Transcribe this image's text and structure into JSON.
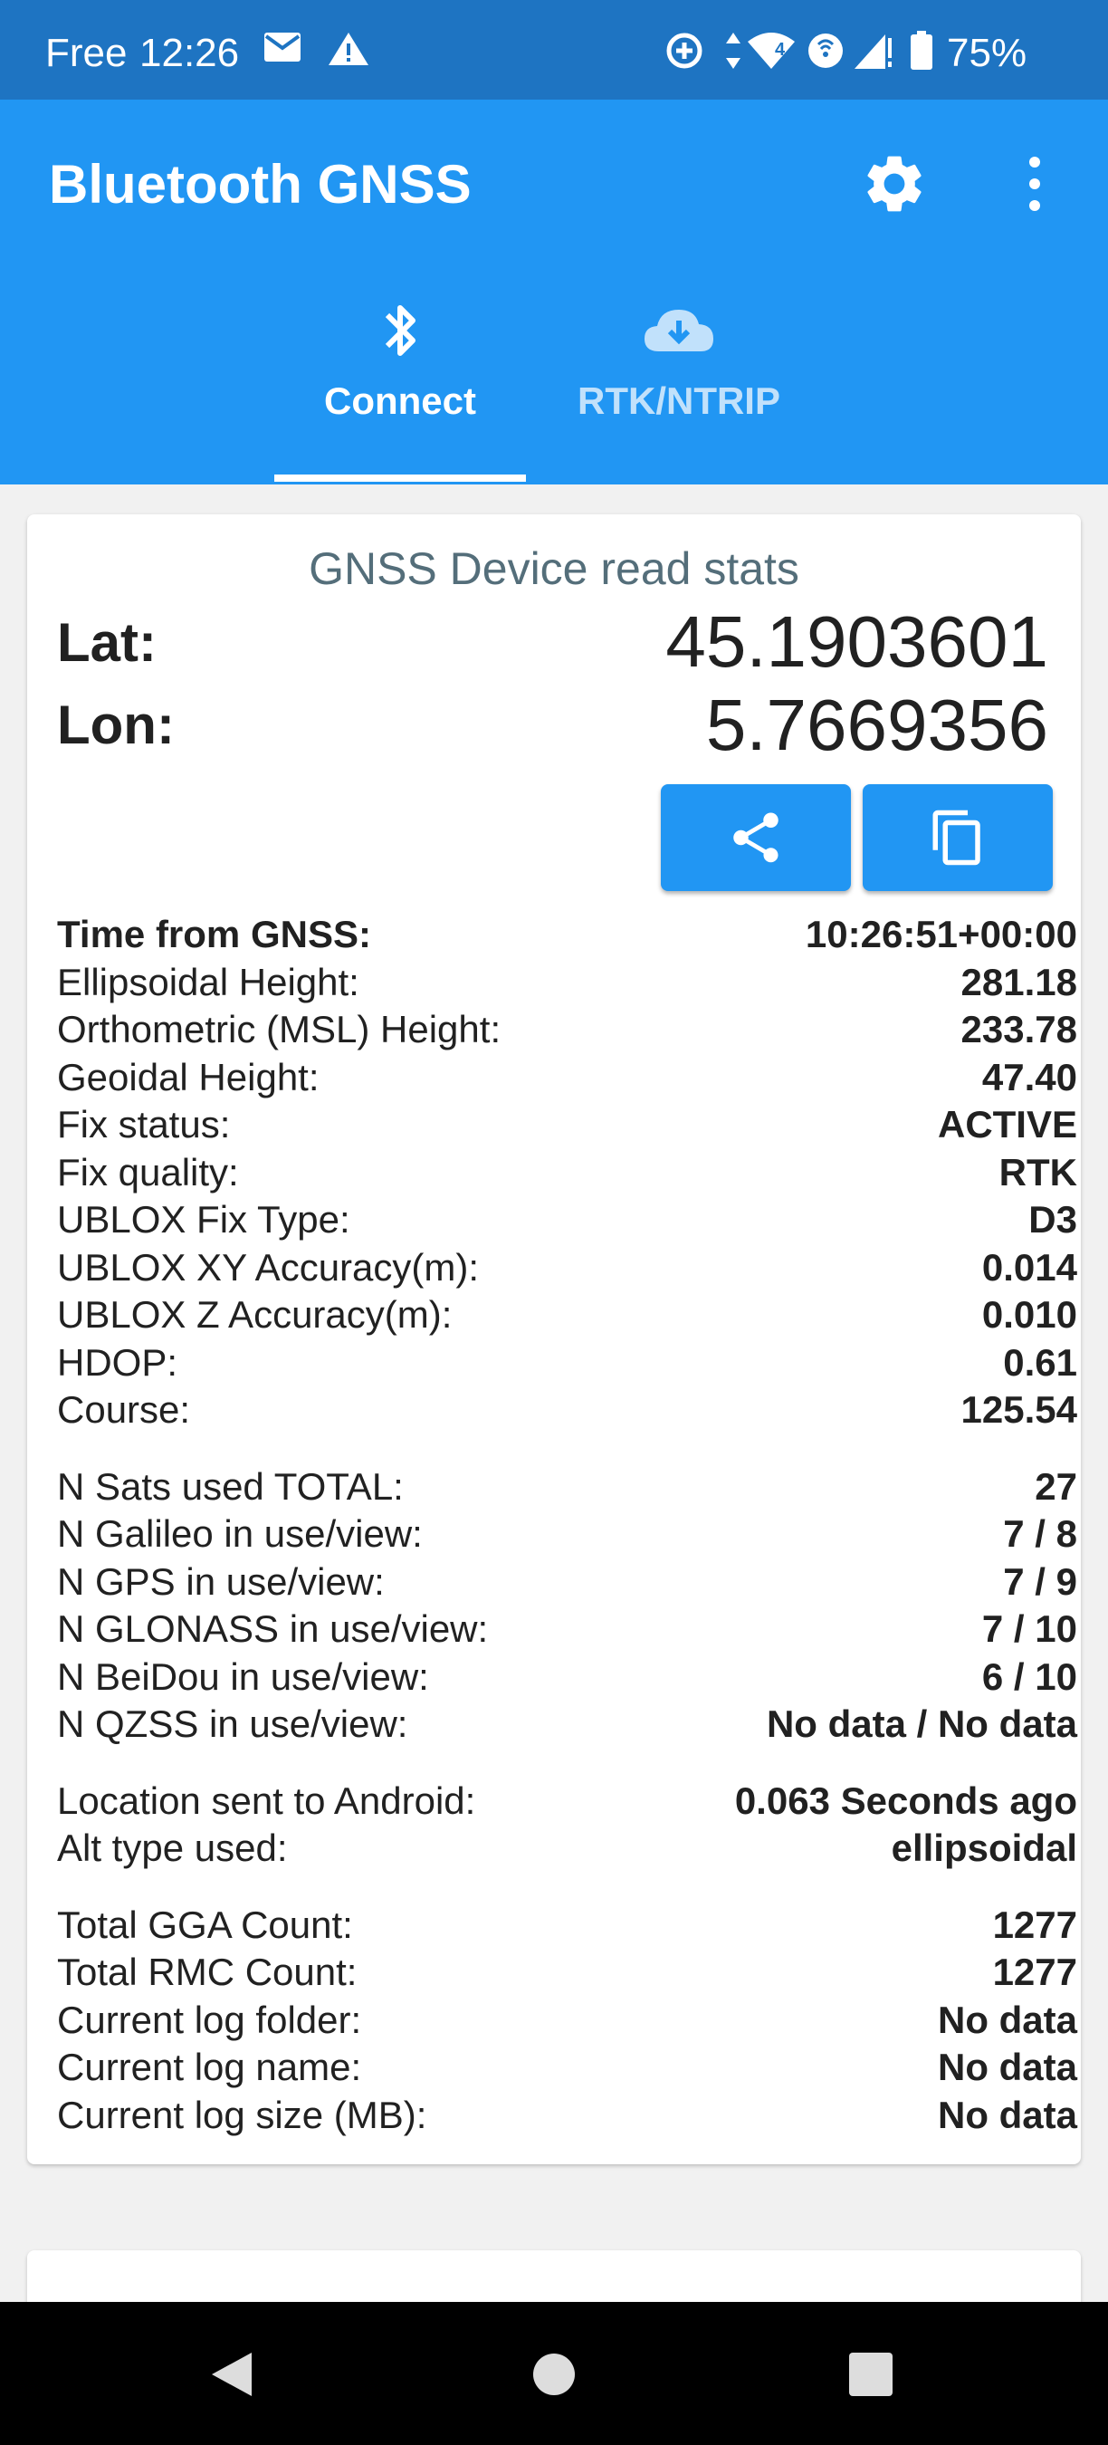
{
  "status_bar": {
    "carrier": "Free",
    "time": "12:26",
    "battery": "75%",
    "network_badge": "4"
  },
  "app_bar": {
    "title": "Bluetooth GNSS",
    "tabs": [
      {
        "label": "Connect",
        "icon": "bluetooth-icon",
        "selected": true
      },
      {
        "label": "RTK/NTRIP",
        "icon": "cloud-download-icon",
        "selected": false
      }
    ]
  },
  "card": {
    "title": "GNSS Device read stats",
    "lat_label": "Lat:",
    "lat_value": "45.1903601",
    "lon_label": "Lon:",
    "lon_value": "5.7669356",
    "stats_groups": [
      [
        {
          "label": "Time from GNSS:",
          "value": "10:26:51+00:00",
          "strong": true
        },
        {
          "label": "Ellipsoidal Height:",
          "value": "281.18"
        },
        {
          "label": "Orthometric (MSL) Height:",
          "value": "233.78"
        },
        {
          "label": "Geoidal Height:",
          "value": "47.40"
        },
        {
          "label": "Fix status:",
          "value": "ACTIVE"
        },
        {
          "label": "Fix quality:",
          "value": "RTK"
        },
        {
          "label": "UBLOX Fix Type:",
          "value": "D3"
        },
        {
          "label": "UBLOX XY Accuracy(m):",
          "value": "0.014"
        },
        {
          "label": "UBLOX Z Accuracy(m):",
          "value": "0.010"
        },
        {
          "label": "HDOP:",
          "value": "0.61"
        },
        {
          "label": "Course:",
          "value": "125.54"
        }
      ],
      [
        {
          "label": "N Sats used TOTAL:",
          "value": "27"
        },
        {
          "label": "N Galileo in use/view:",
          "value": "7 / 8"
        },
        {
          "label": "N GPS in use/view:",
          "value": "7 / 9"
        },
        {
          "label": "N GLONASS in use/view:",
          "value": "7 / 10"
        },
        {
          "label": "N BeiDou in use/view:",
          "value": "6 / 10"
        },
        {
          "label": "N QZSS in use/view:",
          "value": "No data / No data"
        }
      ],
      [
        {
          "label": "Location sent to Android:",
          "value": "0.063 Seconds ago"
        },
        {
          "label": "Alt type used:",
          "value": "ellipsoidal"
        }
      ],
      [
        {
          "label": "Total GGA Count:",
          "value": "1277"
        },
        {
          "label": "Total RMC Count:",
          "value": "1277"
        },
        {
          "label": "Current log folder:",
          "value": "No data"
        },
        {
          "label": "Current log name:",
          "value": "No data"
        },
        {
          "label": "Current log size (MB):",
          "value": "No data"
        }
      ]
    ]
  },
  "colors": {
    "status_bar": "#1e74c2",
    "app_bar": "#2196f3",
    "card_title": "#546e7a",
    "background": "#f1f1f1"
  }
}
